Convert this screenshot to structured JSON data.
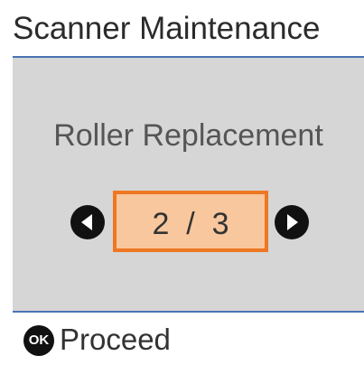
{
  "header": {
    "title": "Scanner Maintenance"
  },
  "main": {
    "subtitle": "Roller Replacement",
    "pager": {
      "text": "2  /  3",
      "current": 2,
      "total": 3,
      "prev_icon": "left-arrow-icon",
      "next_icon": "right-arrow-icon"
    }
  },
  "footer": {
    "ok_icon_text": "OK",
    "proceed_label": "Proceed"
  },
  "colors": {
    "accent_line": "#4a73b4",
    "content_background": "#d6d6d6",
    "selection_fill": "#f8c79d",
    "selection_border": "#ef7722"
  }
}
